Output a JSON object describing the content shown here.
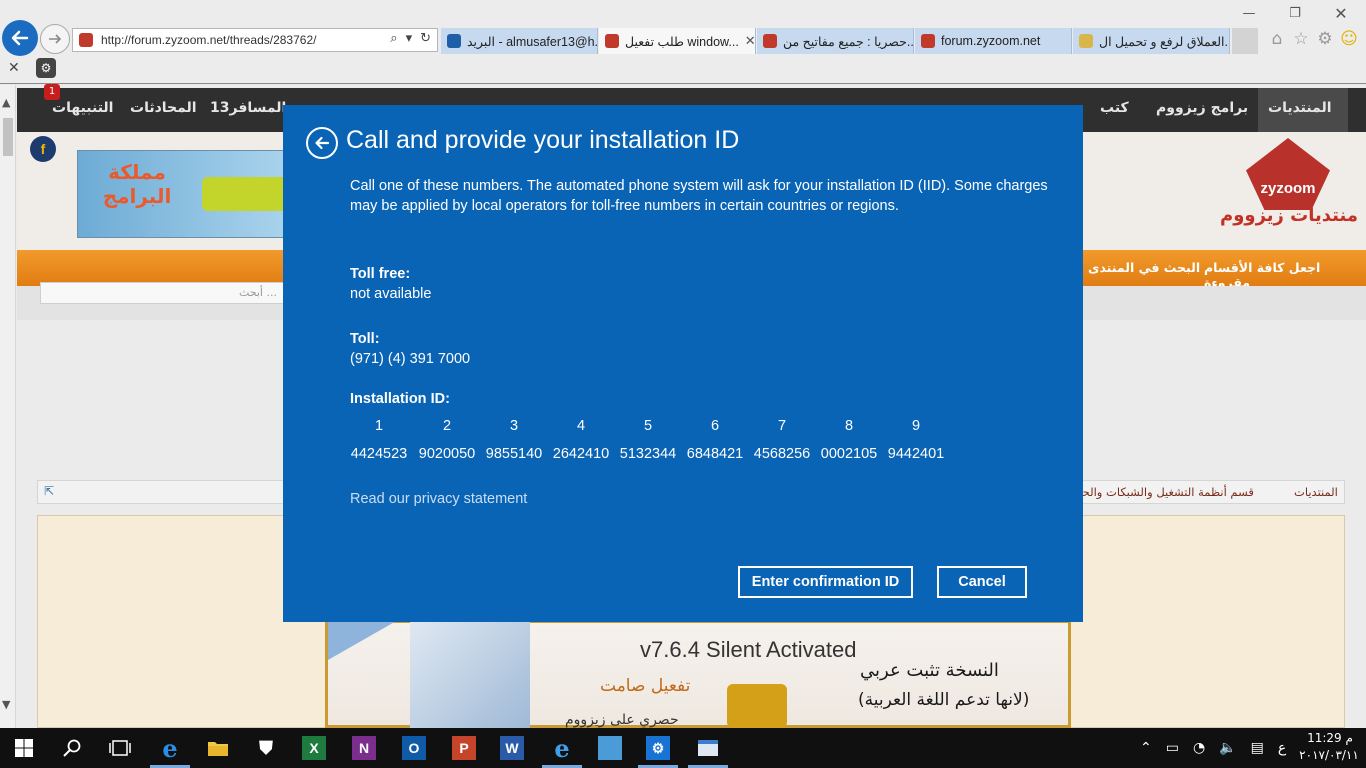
{
  "browser": {
    "url": "http://forum.zyzoom.net/threads/283762/",
    "tabs": [
      {
        "label": "البريد - almusafer13@h...",
        "color": "#1f5fa8"
      },
      {
        "label": "طلب تفعيل window...",
        "color": "#c0392b",
        "active": true
      },
      {
        "label": "حصريا : جميع مفاتيح من...",
        "color": "#c0392b"
      },
      {
        "label": "forum.zyzoom.net",
        "color": "#c0392b"
      },
      {
        "label": "العملاق لرفع و تحميل ال...",
        "color": "#d9b64a"
      }
    ],
    "close_tab_glyph": "✕",
    "cmdbar_close": "✕"
  },
  "forum": {
    "nav": {
      "home": "المنتديات",
      "programs": "برامج زيزووم",
      "books": "كتب",
      "traveler": "المسافر13",
      "conversations": "المحادثات",
      "alerts": "التنبيهات"
    },
    "alerts_count": "1",
    "fb_glyph": "f",
    "banner_text": "مملكة البرامج",
    "logo_brand": "zyzoom",
    "logo_text": "منتديات زيزووم",
    "orange": {
      "mark_read": "اجعل كافة الأقسام مقروءة",
      "search": "البحث في المنتدى"
    },
    "search_placeholder": "أبحث ...",
    "breadcrumb": {
      "home": "المنتديات",
      "section": "قسم أنظمة التشغيل والشبكات والحزم ال"
    },
    "post_image": {
      "title": "v7.6.4 Silent Activated",
      "line1": "النسخة تثبت عربي",
      "line2": "تفعيل صامت",
      "line3": "(لانها تدعم اللغة العربية)",
      "line4": "حصري على زيزووم"
    }
  },
  "dialog": {
    "title": "Call and provide your installation ID",
    "description": "Call one of these numbers. The automated phone system will ask for your installation ID (IID). Some charges may be applied by local operators for toll-free numbers in certain countries or regions.",
    "toll_free_label": "Toll free:",
    "toll_free_value": "not available",
    "toll_label": "Toll:",
    "toll_value": "(971) (4) 391 7000",
    "iid_label": "Installation ID:",
    "iid_groups": [
      {
        "n": "1",
        "v": "4424523"
      },
      {
        "n": "2",
        "v": "9020050"
      },
      {
        "n": "3",
        "v": "9855140"
      },
      {
        "n": "4",
        "v": "2642410"
      },
      {
        "n": "5",
        "v": "5132344"
      },
      {
        "n": "6",
        "v": "6848421"
      },
      {
        "n": "7",
        "v": "4568256"
      },
      {
        "n": "8",
        "v": "0002105"
      },
      {
        "n": "9",
        "v": "9442401"
      }
    ],
    "privacy_link": "Read our privacy statement",
    "confirm_button": "Enter confirmation ID",
    "cancel_button": "Cancel",
    "accent": "#0a64b6"
  },
  "taskbar": {
    "apps": [
      "start-icon",
      "search-icon",
      "task-view-icon",
      "edge-icon",
      "file-explorer-icon",
      "store-icon",
      "excel-icon",
      "onenote-icon",
      "outlook-icon",
      "powerpoint-icon",
      "word-icon",
      "internet-explorer-icon",
      "remote-desktop-icon",
      "settings-icon",
      "window-icon"
    ],
    "excel_letter": "X",
    "onenote_letter": "N",
    "outlook_letter": "O",
    "powerpoint_letter": "P",
    "word_letter": "W",
    "store_glyph": "⛊",
    "language": "ع",
    "time": "11:29 م",
    "date": "٢٠١٧/٠٣/١١"
  }
}
